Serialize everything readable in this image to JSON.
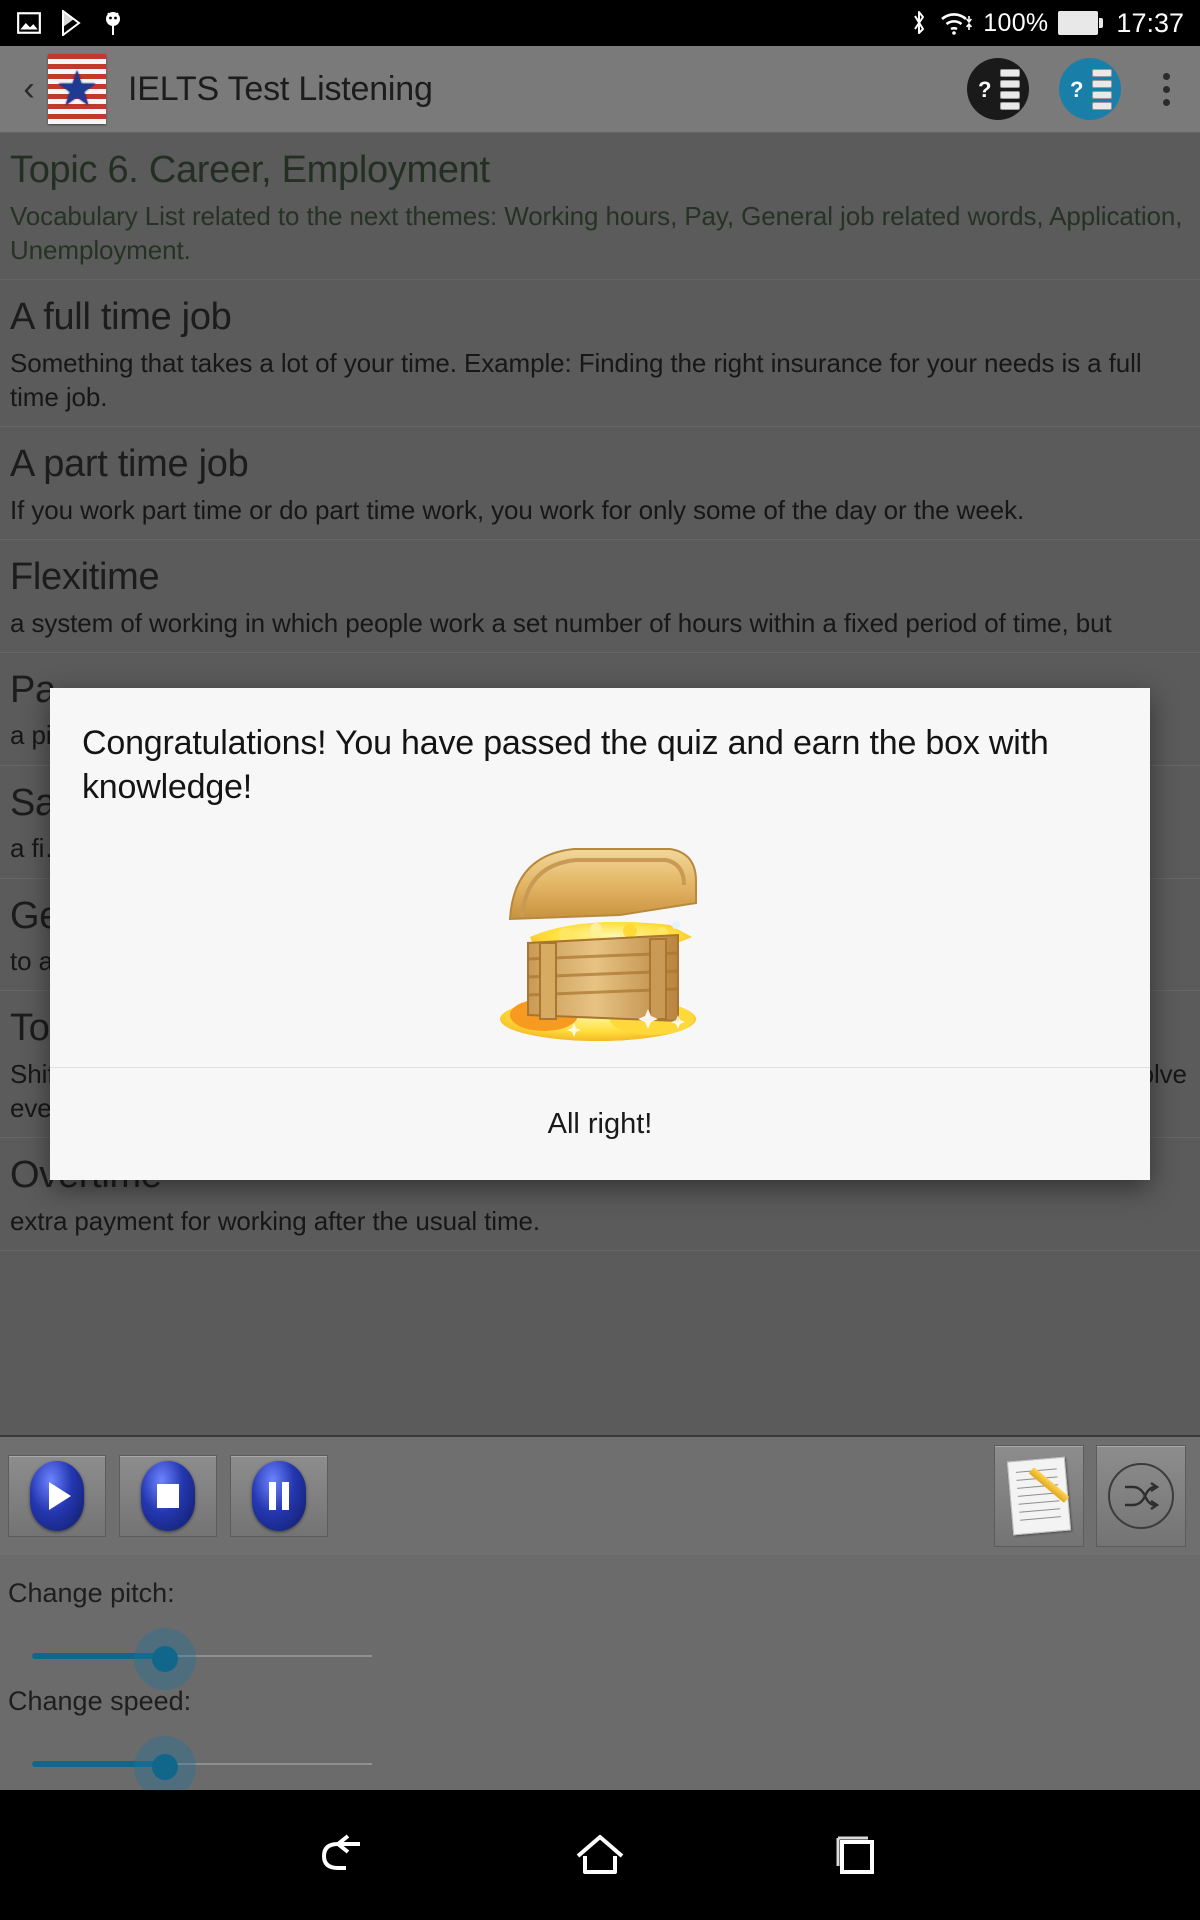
{
  "statusbar": {
    "battery_percent": "100%",
    "time": "17:37",
    "icons": [
      "image-icon",
      "play-store-icon",
      "bug-droid-icon",
      "bluetooth-icon",
      "wifi-icon",
      "battery-icon"
    ]
  },
  "appbar": {
    "back_label": "‹",
    "logo": "us-flag-star-logo",
    "title": "IELTS Test Listening",
    "action_quiz_dark": "quiz-dark-icon",
    "action_quiz_blue": "quiz-blue-icon",
    "overflow": "overflow-menu-icon"
  },
  "content": {
    "entries": [
      {
        "title": "Topic 6. Career, Employment",
        "desc": "Vocabulary List related to the next themes: Working hours, Pay, General job related words, Application, Unemployment."
      },
      {
        "title": "A full time job",
        "desc": "Something that takes a lot of your time. Example: Finding the right insurance for your needs is a full time job."
      },
      {
        "title": "A part time job",
        "desc": "If you work part time or do part time work, you work for only some of the day or the week."
      },
      {
        "title": "Flexitime",
        "desc": "a system of working in which people work a set number of hours within a fixed period of time, but"
      },
      {
        "title": "Pa",
        "desc": "a pi… ons in a…"
      },
      {
        "title": "Sa",
        "desc": "a fi… his"
      },
      {
        "title": "Ge",
        "desc": "to a… joke…"
      },
      {
        "title": "To work in shifts",
        "desc": "Shift work is work that takes place on a schedule outside the traditional 9 am to 5 pm day. It can involve evening or night shifts, early morning shifts, and rotating shifts."
      },
      {
        "title": "Overtime",
        "desc": "extra payment for working after the usual time."
      }
    ]
  },
  "dialog": {
    "title": "Congratulations! You have passed the quiz and earn the box with knowledge!",
    "image": "treasure-chest-image",
    "action_label": "All right!"
  },
  "player": {
    "play_label": "play-icon",
    "stop_label": "stop-icon",
    "pause_label": "pause-icon",
    "notes_label": "notes-icon",
    "shuffle_label": "shuffle-icon",
    "shuffle_glyph": "⤨"
  },
  "sliders": [
    {
      "label": "Change pitch:"
    },
    {
      "label": "Change speed:"
    }
  ],
  "navbar": {
    "back": "nav-back-icon",
    "home": "nav-home-icon",
    "recents": "nav-recents-icon"
  },
  "colors": {
    "accent": "#11678b",
    "app_bar": "#7a7a7a",
    "content_bg": "#6f6f6f",
    "dialog_bg": "#f7f7f7"
  }
}
